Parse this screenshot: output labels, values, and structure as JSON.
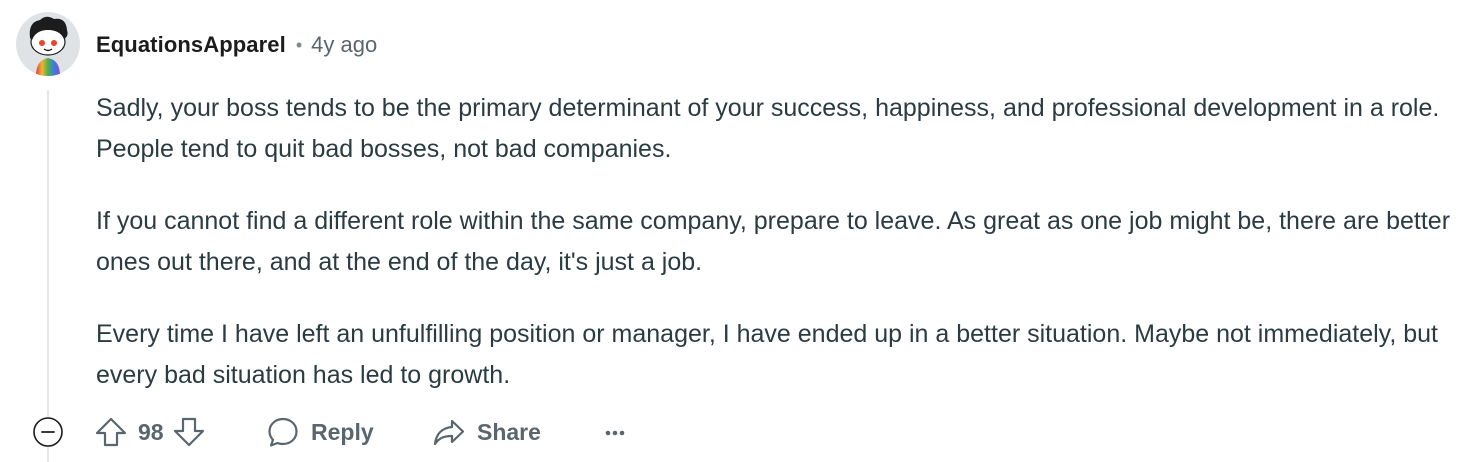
{
  "comment": {
    "username": "EquationsApparel",
    "separator": "•",
    "timestamp": "4y ago",
    "paragraphs": [
      "Sadly, your boss tends to be the primary determinant of your success, happiness, and professional development in a role. People tend to quit bad bosses, not bad companies.",
      "If you cannot find a different role within the same company, prepare to leave. As great as one job might be, there are better ones out there, and at the end of the day, it's just a job.",
      "Every time I have left an unfulfilling position or manager, I have ended up in a better situation. Maybe not immediately, but every bad situation has led to growth."
    ]
  },
  "actions": {
    "score": "98",
    "reply_label": "Reply",
    "share_label": "Share"
  },
  "icons": {
    "avatar": "snoo-avatar-icon",
    "collapse": "collapse-minus-icon",
    "upvote": "upvote-arrow-icon",
    "downvote": "downvote-arrow-icon",
    "reply": "comment-bubble-icon",
    "share": "share-arrow-icon",
    "more": "more-dots-icon"
  },
  "colors": {
    "text": "#2a3c42",
    "meta": "#59666e",
    "thread_line": "#e5e8ea"
  }
}
